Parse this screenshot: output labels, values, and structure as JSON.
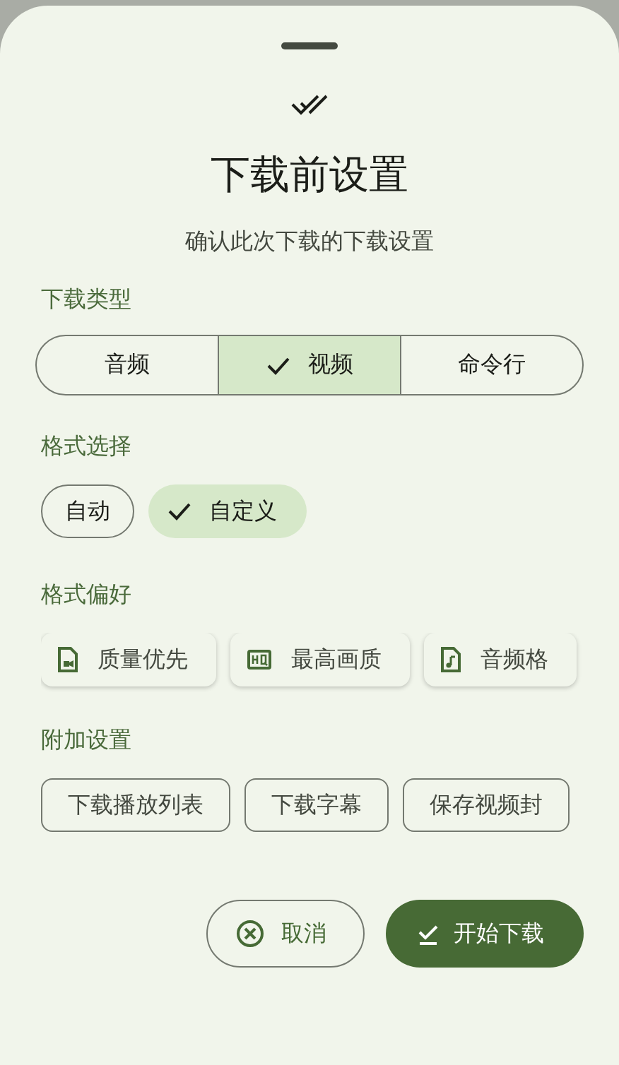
{
  "sheet": {
    "title": "下载前设置",
    "subtitle": "确认此次下载的下载设置"
  },
  "download_type": {
    "label": "下载类型",
    "options": [
      {
        "label": "音频",
        "selected": false
      },
      {
        "label": "视频",
        "selected": true
      },
      {
        "label": "命令行",
        "selected": false
      }
    ]
  },
  "format_select": {
    "label": "格式选择",
    "options": [
      {
        "label": "自动",
        "selected": false
      },
      {
        "label": "自定义",
        "selected": true
      }
    ]
  },
  "format_preference": {
    "label": "格式偏好",
    "chips": [
      {
        "label": "质量优先",
        "kind": "video"
      },
      {
        "label": "最高画质",
        "kind": "hq"
      },
      {
        "label": "音频格",
        "kind": "audio"
      }
    ]
  },
  "extra_settings": {
    "label": "附加设置",
    "chips": [
      {
        "label": "下载播放列表",
        "checked": false
      },
      {
        "label": "下载字幕",
        "checked": false
      },
      {
        "label": "保存视频封",
        "checked": false
      }
    ]
  },
  "buttons": {
    "cancel": "取消",
    "confirm": "开始下载"
  }
}
